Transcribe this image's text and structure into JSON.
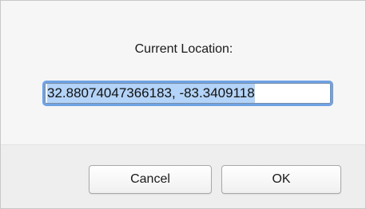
{
  "dialog": {
    "prompt": "Current Location:",
    "location_value": "32.88074047366183, -83.3409118"
  },
  "buttons": {
    "cancel_label": "Cancel",
    "ok_label": "OK"
  },
  "colors": {
    "focus_ring": "#6fa2e4",
    "selection": "#b3d3f8",
    "dialog_bg": "#f6f6f6",
    "button_bar_bg": "#eeeeee"
  }
}
